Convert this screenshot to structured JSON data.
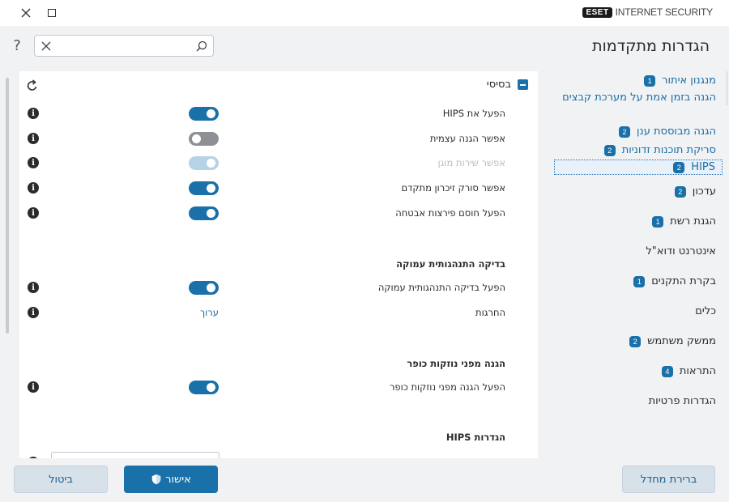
{
  "app": {
    "brand_logo": "ESET",
    "brand_name": "INTERNET SECURITY"
  },
  "header": {
    "title": "הגדרות מתקדמות",
    "help_glyph": "?",
    "search_value": "",
    "search_placeholder": ""
  },
  "sidebar": {
    "items": [
      {
        "label": "מנגנון איתור",
        "badge": "1"
      },
      {
        "label": "עדכון",
        "badge": "2"
      },
      {
        "label": "הגנת רשת",
        "badge": "1"
      },
      {
        "label": "אינטרנט ודוא\"ל",
        "badge": ""
      },
      {
        "label": "בקרת התקנים",
        "badge": "1"
      },
      {
        "label": "כלים",
        "badge": ""
      },
      {
        "label": "ממשק משתמש",
        "badge": "2"
      },
      {
        "label": "התראות",
        "badge": "4"
      },
      {
        "label": "הגדרות פרטיות",
        "badge": ""
      }
    ],
    "subitems": [
      {
        "label": "הגנה בזמן אמת על מערכת קבצים",
        "badge": ""
      },
      {
        "label": "הגנה מבוססת ענן",
        "badge": "2"
      },
      {
        "label": "סריקת תוכנות זדוניות",
        "badge": "2"
      },
      {
        "label": "HIPS",
        "badge": "2"
      }
    ]
  },
  "section": {
    "title": "בסיסי",
    "rows": [
      {
        "label": "הפעל את HIPS",
        "state": "on"
      },
      {
        "label": "אפשר הגנה עצמית",
        "state": "off"
      },
      {
        "label": "אפשר שירות מוגן",
        "state": "disabled"
      },
      {
        "label": "אפשר סורק זיכרון מתקדם",
        "state": "on"
      },
      {
        "label": "הפעל חוסם פירצות אבטחה",
        "state": "on"
      }
    ],
    "deep_behavior": {
      "heading": "בדיקה התנהגותית עמוקה",
      "enable_label": "הפעל בדיקה התנהגותית עמוקה",
      "enable_state": "on",
      "exclusions_label": "החרגות",
      "exclusions_action": "ערוך"
    },
    "ransomware": {
      "heading": "הגנה מפני נוזקות כופר",
      "enable_label": "הפעל הגנה מפני נוזקות כופר",
      "enable_state": "on"
    },
    "hips_settings": {
      "heading": "הגדרות HIPS"
    }
  },
  "footer": {
    "cancel": "ביטול",
    "ok": "אישור",
    "default": "ברירת מחדל"
  },
  "colors": {
    "accent": "#1a70a8",
    "link": "#1a6da4",
    "toggle_off": "#8d9196",
    "toggle_disabled": "#b6d3e6"
  }
}
